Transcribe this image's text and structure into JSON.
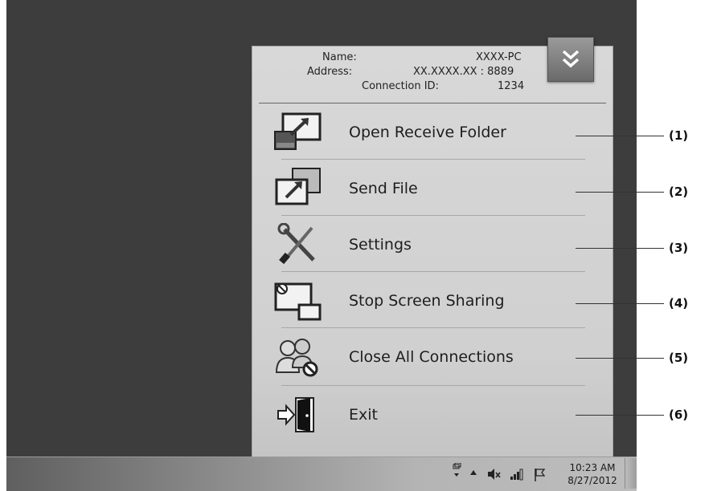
{
  "info": {
    "name_label": "Name:",
    "name_value": "XXXX-PC",
    "address_label": "Address:",
    "address_value": "XX.XXXX.XX : 8889",
    "connection_id_label": "Connection ID:",
    "connection_id_value": "1234"
  },
  "menu": {
    "items": [
      {
        "label": "Open Receive Folder",
        "icon": "open-folder-icon"
      },
      {
        "label": "Send File",
        "icon": "send-file-icon"
      },
      {
        "label": "Settings",
        "icon": "settings-tools-icon"
      },
      {
        "label": "Stop Screen Sharing",
        "icon": "stop-sharing-icon"
      },
      {
        "label": "Close All Connections",
        "icon": "close-connections-icon"
      },
      {
        "label": "Exit",
        "icon": "exit-door-icon"
      }
    ]
  },
  "callouts": [
    "(1)",
    "(2)",
    "(3)",
    "(4)",
    "(5)",
    "(6)"
  ],
  "taskbar": {
    "time": "10:23 AM",
    "date": "8/27/2012"
  }
}
